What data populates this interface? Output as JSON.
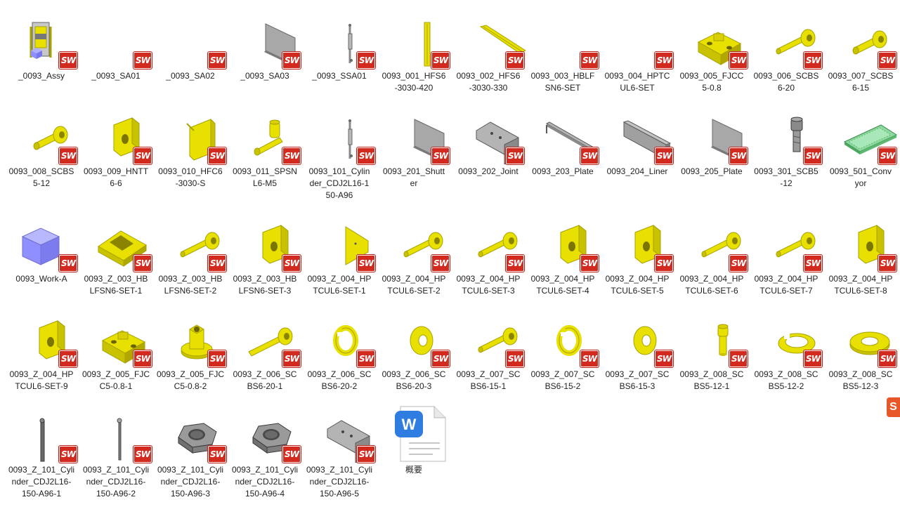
{
  "folder": {
    "items": [
      {
        "name": "_0093_Assy",
        "icon": "assembly-icon",
        "type": "sw"
      },
      {
        "name": "_0093_SA01",
        "icon": "blank-part-icon",
        "type": "sw"
      },
      {
        "name": "_0093_SA02",
        "icon": "blank-part-icon",
        "type": "sw"
      },
      {
        "name": "_0093_SA03",
        "icon": "grey-plate-icon",
        "type": "sw"
      },
      {
        "name": "_0093_SSA01",
        "icon": "cylinder-rod-icon",
        "type": "sw"
      },
      {
        "name": "0093_001_HFS6\n-3030-420",
        "icon": "yellow-profile-vertical-icon",
        "type": "sw"
      },
      {
        "name": "0093_002_HFS6\n-3030-330",
        "icon": "yellow-profile-diagonal-icon",
        "type": "sw"
      },
      {
        "name": "0093_003_HBLF\nSN6-SET",
        "icon": "blank-part-icon",
        "type": "sw"
      },
      {
        "name": "0093_004_HPTC\nUL6-SET",
        "icon": "blank-part-icon",
        "type": "sw"
      },
      {
        "name": "0093_005_FJCC\n5-0.8",
        "icon": "yellow-block-icon",
        "type": "sw"
      },
      {
        "name": "0093_006_SCBS\n6-20",
        "icon": "yellow-bolt-icon",
        "type": "sw"
      },
      {
        "name": "0093_007_SCBS\n6-15",
        "icon": "yellow-bolt-short-icon",
        "type": "sw"
      },
      {
        "name": "0093_008_SCBS\n5-12",
        "icon": "yellow-bolt-short-icon",
        "type": "sw"
      },
      {
        "name": "0093_009_HNTT\n6-6",
        "icon": "yellow-nut-icon",
        "type": "sw"
      },
      {
        "name": "0093_010_HFC6\n-3030-S",
        "icon": "yellow-cap-icon",
        "type": "sw"
      },
      {
        "name": "0093_011_SPSN\nL6-M5",
        "icon": "yellow-fitting-icon",
        "type": "sw"
      },
      {
        "name": "0093_101_Cylin\nder_CDJ2L16-1\n50-A96",
        "icon": "cylinder-rod-icon",
        "type": "sw"
      },
      {
        "name": "0093_201_Shutt\ner",
        "icon": "grey-plate-icon",
        "type": "sw"
      },
      {
        "name": "0093_202_Joint",
        "icon": "grey-bracket-icon",
        "type": "sw"
      },
      {
        "name": "0093_203_Plate",
        "icon": "grey-long-plate-icon",
        "type": "sw"
      },
      {
        "name": "0093_204_Liner",
        "icon": "grey-liner-icon",
        "type": "sw"
      },
      {
        "name": "0093_205_Plate",
        "icon": "grey-plate-icon",
        "type": "sw"
      },
      {
        "name": "0093_301_SCB5\n-12",
        "icon": "grey-bolt-icon",
        "type": "sw"
      },
      {
        "name": "0093_501_Conv\nyor",
        "icon": "green-conveyor-icon",
        "type": "sw"
      },
      {
        "name": "0093_Work-A",
        "icon": "purple-cube-icon",
        "type": "sw"
      },
      {
        "name": "0093_Z_003_HB\nLFSN6-SET-1",
        "icon": "yellow-wedge-icon",
        "type": "sw"
      },
      {
        "name": "0093_Z_003_HB\nLFSN6-SET-2",
        "icon": "yellow-bolt-icon",
        "type": "sw"
      },
      {
        "name": "0093_Z_003_HB\nLFSN6-SET-3",
        "icon": "yellow-nut-icon",
        "type": "sw"
      },
      {
        "name": "0093_Z_004_HP\nTCUL6-SET-1",
        "icon": "yellow-tab-icon",
        "type": "sw"
      },
      {
        "name": "0093_Z_004_HP\nTCUL6-SET-2",
        "icon": "yellow-bolt-icon",
        "type": "sw"
      },
      {
        "name": "0093_Z_004_HP\nTCUL6-SET-3",
        "icon": "yellow-bolt-icon",
        "type": "sw"
      },
      {
        "name": "0093_Z_004_HP\nTCUL6-SET-4",
        "icon": "yellow-nut-icon",
        "type": "sw"
      },
      {
        "name": "0093_Z_004_HP\nTCUL6-SET-5",
        "icon": "yellow-nut-icon",
        "type": "sw"
      },
      {
        "name": "0093_Z_004_HP\nTCUL6-SET-6",
        "icon": "yellow-bolt-icon",
        "type": "sw"
      },
      {
        "name": "0093_Z_004_HP\nTCUL6-SET-7",
        "icon": "yellow-bolt-icon",
        "type": "sw"
      },
      {
        "name": "0093_Z_004_HP\nTCUL6-SET-8",
        "icon": "yellow-nut-icon",
        "type": "sw"
      },
      {
        "name": "0093_Z_004_HP\nTCUL6-SET-9",
        "icon": "yellow-nut-icon",
        "type": "sw"
      },
      {
        "name": "0093_Z_005_FJC\nC5-0.8-1",
        "icon": "yellow-block-icon",
        "type": "sw"
      },
      {
        "name": "0093_Z_005_FJC\nC5-0.8-2",
        "icon": "yellow-flange-icon",
        "type": "sw"
      },
      {
        "name": "0093_Z_006_SC\nBS6-20-1",
        "icon": "yellow-bolt-long-icon",
        "type": "sw"
      },
      {
        "name": "0093_Z_006_SC\nBS6-20-2",
        "icon": "yellow-split-washer-icon",
        "type": "sw"
      },
      {
        "name": "0093_Z_006_SC\nBS6-20-3",
        "icon": "yellow-washer-icon",
        "type": "sw"
      },
      {
        "name": "0093_Z_007_SC\nBS6-15-1",
        "icon": "yellow-bolt-icon",
        "type": "sw"
      },
      {
        "name": "0093_Z_007_SC\nBS6-15-2",
        "icon": "yellow-split-washer-icon",
        "type": "sw"
      },
      {
        "name": "0093_Z_007_SC\nBS6-15-3",
        "icon": "yellow-washer-icon",
        "type": "sw"
      },
      {
        "name": "0093_Z_008_SC\nBS5-12-1",
        "icon": "yellow-bolt-vertical-icon",
        "type": "sw"
      },
      {
        "name": "0093_Z_008_SC\nBS5-12-2",
        "icon": "yellow-split-washer-flat-icon",
        "type": "sw"
      },
      {
        "name": "0093_Z_008_SC\nBS5-12-3",
        "icon": "yellow-washer-flat-icon",
        "type": "sw"
      },
      {
        "name": "0093_Z_101_Cyli\nnder_CDJ2L16-\n150-A96-1",
        "icon": "grey-rod-icon",
        "type": "sw"
      },
      {
        "name": "0093_Z_101_Cyli\nnder_CDJ2L16-\n150-A96-2",
        "icon": "grey-thin-rod-icon",
        "type": "sw"
      },
      {
        "name": "0093_Z_101_Cyli\nnder_CDJ2L16-\n150-A96-3",
        "icon": "grey-hex-nut-icon",
        "type": "sw"
      },
      {
        "name": "0093_Z_101_Cyli\nnder_CDJ2L16-\n150-A96-4",
        "icon": "grey-hex-nut-icon",
        "type": "sw"
      },
      {
        "name": "0093_Z_101_Cyli\nnder_CDJ2L16-\n150-A96-5",
        "icon": "grey-bracket-icon",
        "type": "sw"
      },
      {
        "name": "概要",
        "icon": "wps-document-icon",
        "type": "doc"
      }
    ]
  },
  "badges": {
    "sw_text": "SW",
    "wps_letter": "W",
    "side_badge": "S"
  },
  "colors": {
    "yellow": "#e8e000",
    "yellow_dark": "#a8a200",
    "grey": "#9a9a9a",
    "grey_dark": "#5a5a5a",
    "sw_red": "#d32a20",
    "wps_blue": "#2f7de1",
    "purple": "#8f8fff",
    "green": "#8fd8a0"
  }
}
